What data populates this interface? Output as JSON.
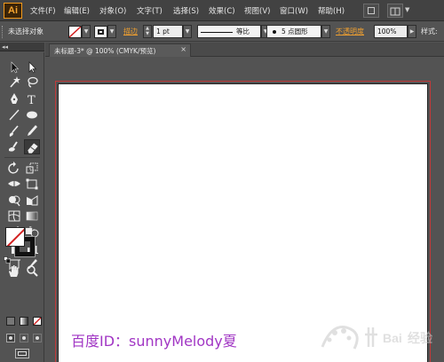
{
  "app": {
    "logo": "Ai"
  },
  "menubar": {
    "items": [
      "文件(F)",
      "编辑(E)",
      "对象(O)",
      "文字(T)",
      "选择(S)",
      "效果(C)",
      "视图(V)",
      "窗口(W)",
      "帮助(H)"
    ]
  },
  "controlbar": {
    "selection_status": "未选择对象",
    "stroke_link": "描边",
    "stroke_weight": "1 pt",
    "stroke_profile": "等比",
    "brush": "5 点圆形",
    "opacity_link": "不透明度",
    "opacity_value": "100%",
    "style_label": "样式:"
  },
  "document": {
    "tab_title": "未标题-3* @ 100% (CMYK/预览)",
    "close_glyph": "×"
  },
  "overlay": {
    "caption": "百度ID：sunnyMelody夏"
  },
  "colors": {
    "accent": "#f39a1c",
    "artboard_bleed": "#c23a3a",
    "caption": "#a136c4",
    "no_fill_slash": "#d22020"
  },
  "tools": [
    "selection-tool",
    "direct-selection-tool",
    "magic-wand-tool",
    "lasso-tool",
    "pen-tool",
    "type-tool",
    "line-segment-tool",
    "ellipse-tool",
    "paintbrush-tool",
    "pencil-tool",
    "blob-brush-tool",
    "eraser-tool",
    "rotate-tool",
    "scale-tool",
    "width-tool",
    "free-transform-tool",
    "shape-builder-tool",
    "perspective-grid-tool",
    "mesh-tool",
    "gradient-tool",
    "eyedropper-tool",
    "blend-tool",
    "symbol-sprayer-tool",
    "column-graph-tool",
    "artboard-tool",
    "slice-tool",
    "hand-tool",
    "zoom-tool"
  ]
}
